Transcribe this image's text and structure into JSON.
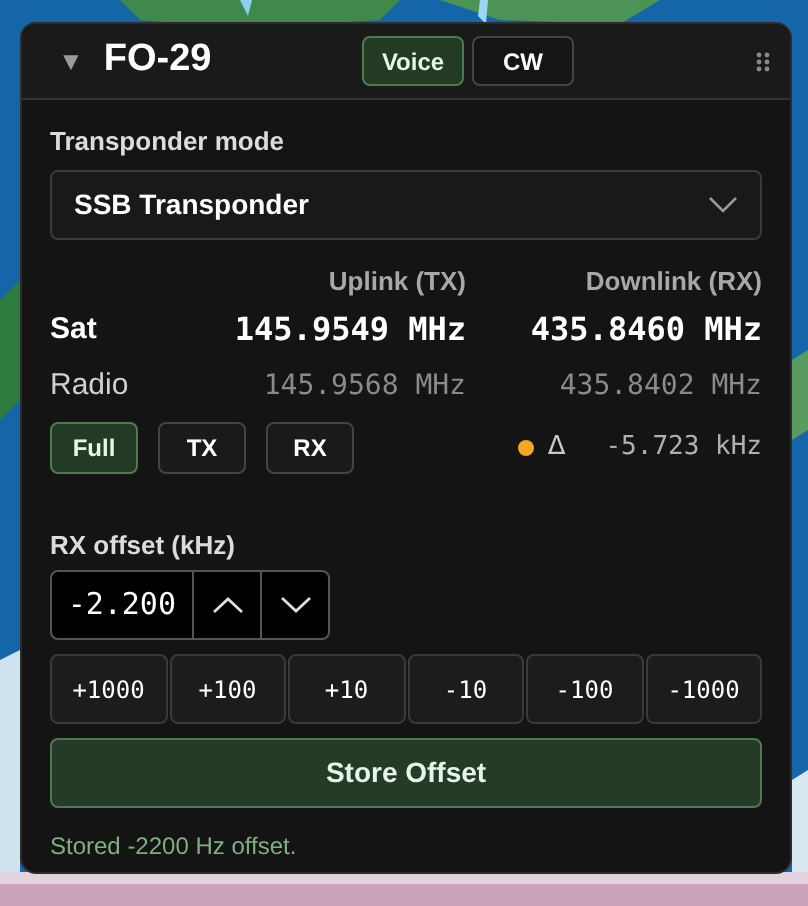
{
  "header": {
    "collapse_icon": "▼",
    "title": "FO-29",
    "modes": [
      {
        "label": "Voice",
        "selected": true
      },
      {
        "label": "CW",
        "selected": false
      }
    ]
  },
  "transponder": {
    "label": "Transponder mode",
    "value": "SSB Transponder"
  },
  "frequencies": {
    "columns": [
      "Uplink (TX)",
      "Downlink (RX)"
    ],
    "rows": [
      {
        "kind": "sat",
        "label": "Sat",
        "uplink": "145.9549 MHz",
        "downlink": "435.8460 MHz"
      },
      {
        "kind": "radio",
        "label": "Radio",
        "uplink": "145.9568 MHz",
        "downlink": "435.8402 MHz"
      }
    ]
  },
  "tracking": [
    {
      "label": "Full",
      "selected": true
    },
    {
      "label": "TX",
      "selected": false
    },
    {
      "label": "RX",
      "selected": false
    }
  ],
  "delta": {
    "symbol": "Δ",
    "value": "-5.723 kHz"
  },
  "rx_offset": {
    "label": "RX offset (kHz)",
    "value": "-2.200",
    "steps": [
      "+1000",
      "+100",
      "+10",
      "-10",
      "-100",
      "-1000"
    ],
    "store_button": "Store Offset",
    "status": "Stored -2200 Hz offset."
  }
}
